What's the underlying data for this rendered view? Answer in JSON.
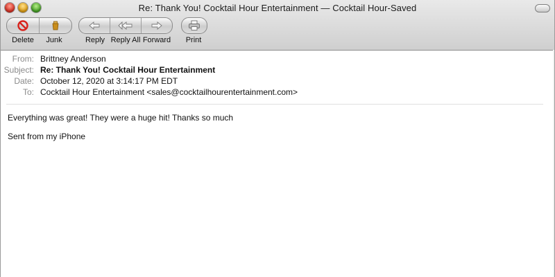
{
  "window": {
    "title": "Re: Thank You! Cocktail Hour Entertainment — Cocktail Hour-Saved"
  },
  "toolbar": {
    "delete_label": "Delete",
    "junk_label": "Junk",
    "reply_label": "Reply",
    "reply_all_label": "Reply All",
    "forward_label": "Forward",
    "print_label": "Print",
    "icons": {
      "delete": "no-entry-icon",
      "junk": "junk-bag-icon",
      "reply": "reply-arrow-icon",
      "reply_all": "reply-all-arrow-icon",
      "forward": "forward-arrow-icon",
      "print": "printer-icon"
    }
  },
  "header": {
    "from_label": "From:",
    "from_value": "Brittney Anderson",
    "subject_label": "Subject:",
    "subject_value": "Re: Thank You! Cocktail Hour Entertainment",
    "date_label": "Date:",
    "date_value": "October 12, 2020 at 3:14:17 PM EDT",
    "to_label": "To:",
    "to_value": "Cocktail Hour Entertainment <sales@cocktailhourentertainment.com>"
  },
  "message": {
    "line1": "Everything was great! They were a huge hit! Thanks so much",
    "line2": "Sent from my iPhone"
  },
  "colors": {
    "delete_red": "#d8231c",
    "junk_gold": "#c98d1c",
    "label_gray": "#8a8a8a"
  }
}
